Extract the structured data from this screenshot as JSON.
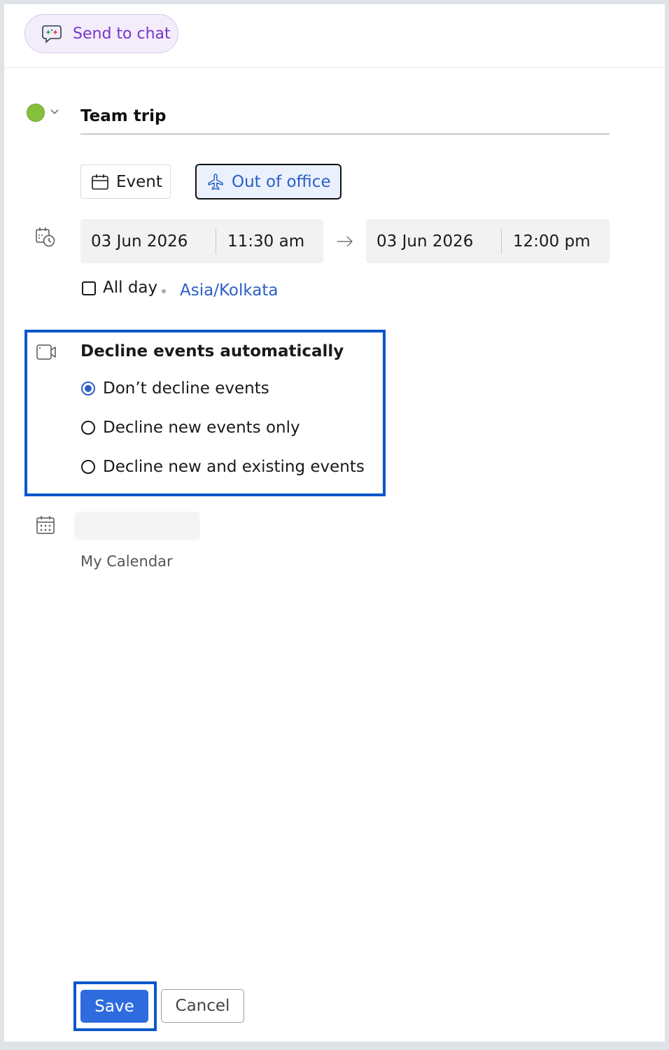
{
  "send_to_chat": {
    "label": "Send to chat",
    "icon": "chat-sparkle-icon"
  },
  "event": {
    "color": "#86bf3c",
    "title": "Team trip"
  },
  "event_types": [
    {
      "label": "Event",
      "icon": "calendar-icon",
      "selected": false
    },
    {
      "label": "Out of office",
      "icon": "airplane-icon",
      "selected": true
    }
  ],
  "datetime": {
    "start_date": "03 Jun 2026",
    "start_time": "11:30 am",
    "end_date": "03 Jun 2026",
    "end_time": "12:00 pm",
    "all_day_label": "All day",
    "all_day_checked": false,
    "timezone": "Asia/Kolkata"
  },
  "decline": {
    "title": "Decline events automatically",
    "options": [
      {
        "label": "Don’t decline events",
        "selected": true
      },
      {
        "label": "Decline new events only",
        "selected": false
      },
      {
        "label": "Decline new and existing events",
        "selected": false
      }
    ]
  },
  "calendar": {
    "owner": "",
    "name": "My Calendar"
  },
  "actions": {
    "save": "Save",
    "cancel": "Cancel"
  },
  "colors": {
    "accent": "#2e6bde",
    "highlight": "#0b57c9",
    "send_chat_text": "#7a35c9",
    "link": "#2d5fc4"
  }
}
